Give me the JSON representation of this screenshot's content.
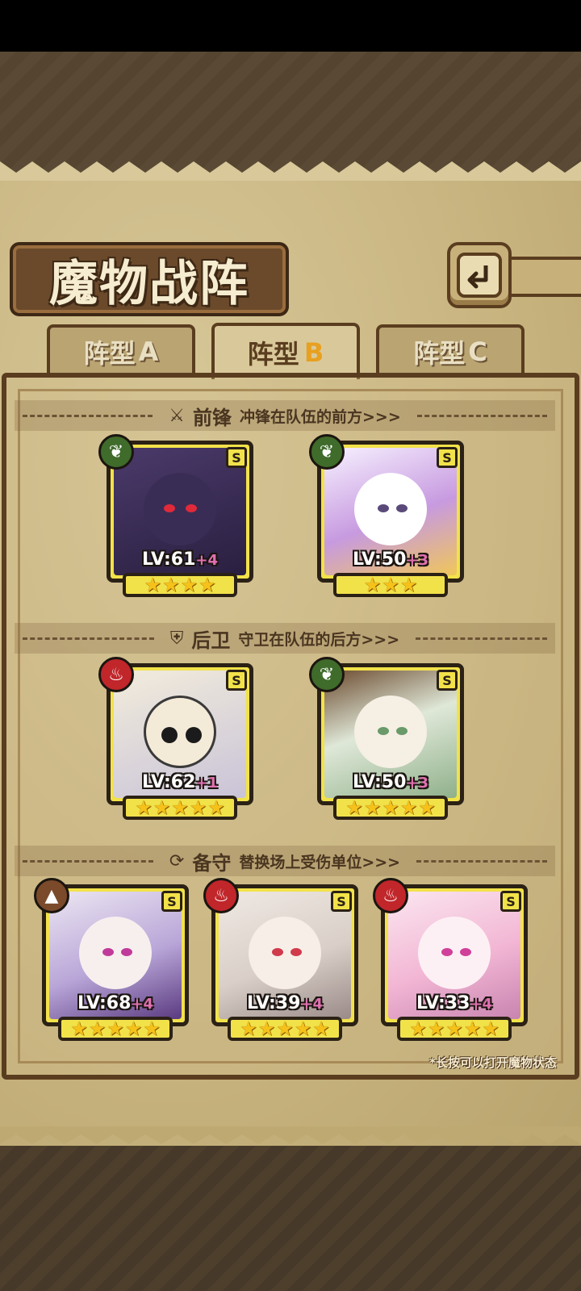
{
  "title": "魔物战阵",
  "tabs": [
    {
      "label": "阵型",
      "letter": "A",
      "active": false
    },
    {
      "label": "阵型",
      "letter": "B",
      "active": true
    },
    {
      "label": "阵型",
      "letter": "C",
      "active": false
    }
  ],
  "sections": {
    "vanguard": {
      "name": "前锋",
      "desc": "冲锋在队伍的前方>>>",
      "icon": "sword-icon"
    },
    "rearguard": {
      "name": "后卫",
      "desc": "守卫在队伍的后方>>>",
      "icon": "shield-icon"
    },
    "reserve": {
      "name": "备守",
      "desc": "替换场上受伤单位>>>",
      "icon": "swap-icon"
    }
  },
  "cards": [
    {
      "level": "LV:61",
      "plus": "+4",
      "rank": "S",
      "stars": 4,
      "element": "nature-icon"
    },
    {
      "level": "LV:50",
      "plus": "+3",
      "rank": "S",
      "stars": 3,
      "element": "nature-icon"
    },
    {
      "level": "LV:62",
      "plus": "+1",
      "rank": "S",
      "stars": 5,
      "element": "fire-icon"
    },
    {
      "level": "LV:50",
      "plus": "+3",
      "rank": "S",
      "stars": 5,
      "element": "nature-icon"
    },
    {
      "level": "LV:68",
      "plus": "+4",
      "rank": "S",
      "stars": 5,
      "element": "earth-icon"
    },
    {
      "level": "LV:39",
      "plus": "+4",
      "rank": "S",
      "stars": 5,
      "element": "fire-icon"
    },
    {
      "level": "LV:33",
      "plus": "+4",
      "rank": "S",
      "stars": 5,
      "element": "fire-icon"
    }
  ],
  "hint": "*长按可以打开魔物状态",
  "colors": {
    "frame": "#f2e24a",
    "accent": "#e8a020",
    "plus": "#e070b0"
  }
}
